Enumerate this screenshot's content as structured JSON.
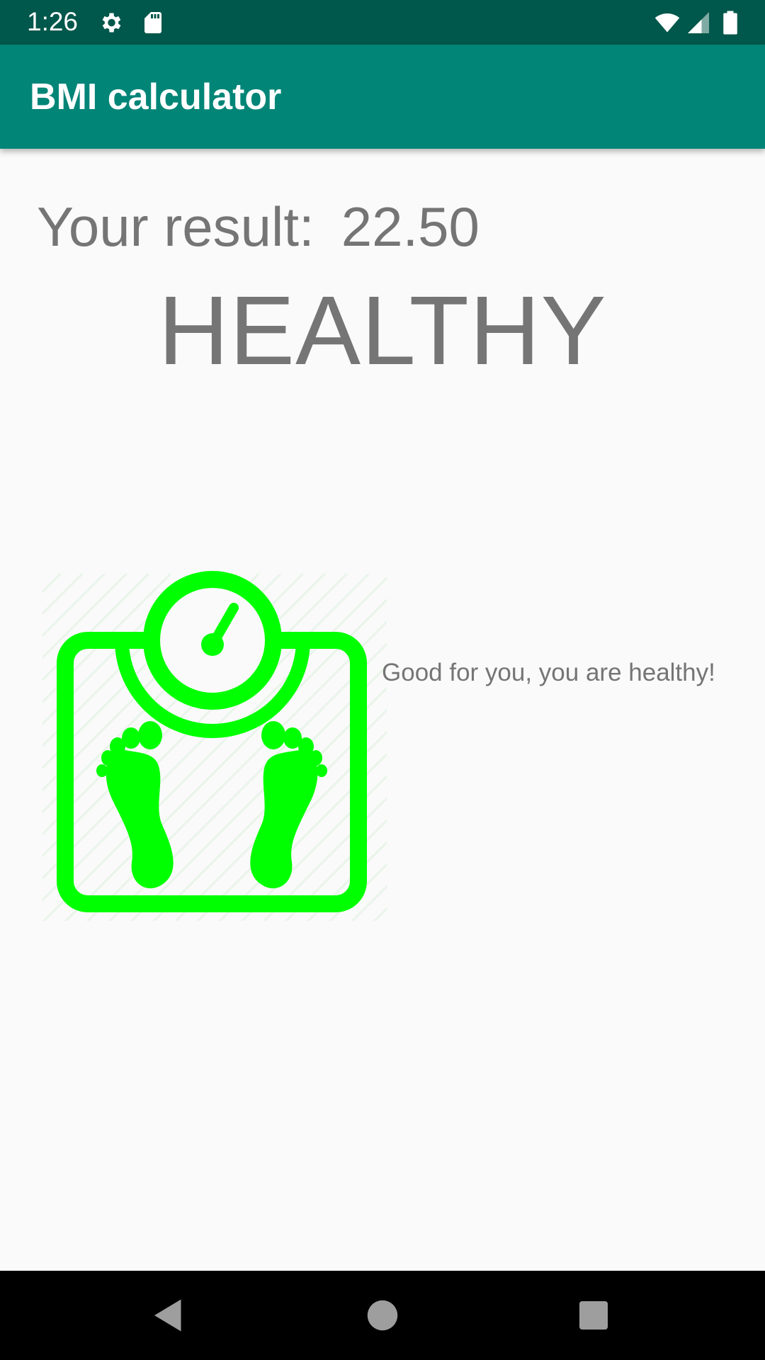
{
  "status_bar": {
    "time": "1:26",
    "icons": [
      "settings-icon",
      "sd-card-icon",
      "wifi-icon",
      "signal-icon",
      "battery-icon"
    ]
  },
  "app_bar": {
    "title": "BMI calculator"
  },
  "result": {
    "label": "Your result:",
    "value": "22.50",
    "category": "HEALTHY",
    "message": "Good for you, you are healthy!"
  },
  "illustration": {
    "icon": "bathroom-scale-icon",
    "color": "#00ff00"
  },
  "nav_bar": {
    "icons": [
      "back-icon",
      "home-icon",
      "recents-icon"
    ]
  },
  "colors": {
    "status_bar": "#00574b",
    "app_bar": "#008577",
    "text": "#757575",
    "background": "#fafafa"
  }
}
